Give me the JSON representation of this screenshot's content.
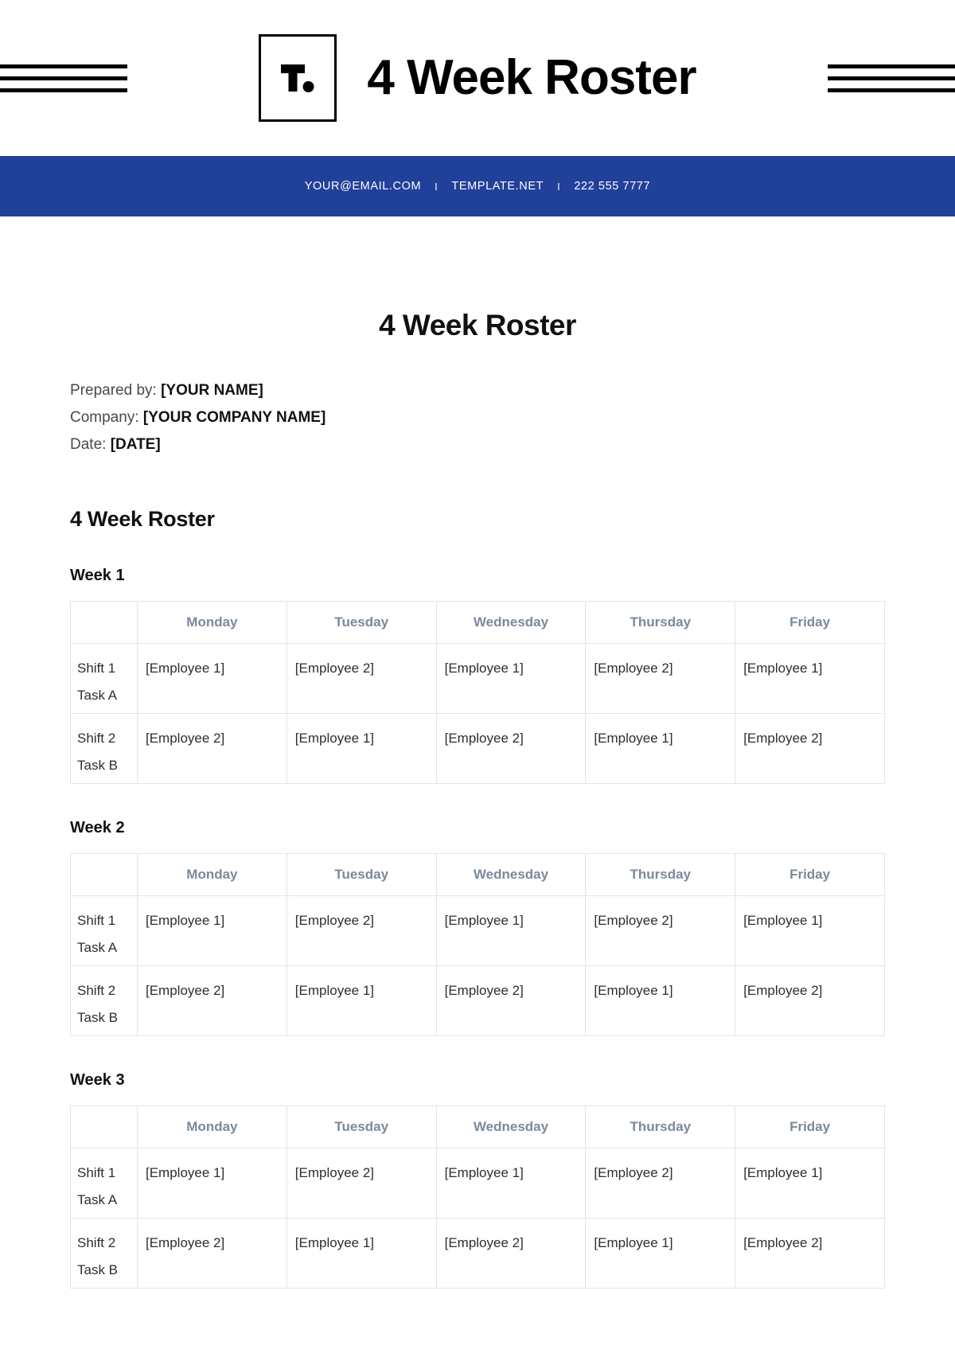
{
  "masthead": {
    "logo_letter": "T.",
    "title": "4 Week Roster",
    "decor_icon_left": "three-lines-icon",
    "decor_icon_right": "three-lines-icon"
  },
  "contact_bar": {
    "background_color": "#21409A",
    "email": "YOUR@EMAIL.COM",
    "separator": "I",
    "website": "TEMPLATE.NET",
    "phone": "222 555 7777"
  },
  "document": {
    "title": "4 Week Roster",
    "meta": [
      {
        "label": "Prepared by:",
        "value": "[YOUR NAME]"
      },
      {
        "label": "Company:",
        "value": "[YOUR COMPANY NAME]"
      },
      {
        "label": "Date:",
        "value": "[DATE]"
      }
    ],
    "section_heading": "4 Week Roster"
  },
  "table_columns": [
    "",
    "Monday",
    "Tuesday",
    "Wednesday",
    "Thursday",
    "Friday"
  ],
  "weeks": [
    {
      "heading": "Week 1",
      "rows": [
        {
          "label_line1": "Shift 1",
          "label_line2": "Task A",
          "cells": [
            "[Employee 1]",
            "[Employee 2]",
            "[Employee 1]",
            "[Employee 2]",
            "[Employee 1]"
          ]
        },
        {
          "label_line1": "Shift 2",
          "label_line2": "Task B",
          "cells": [
            "[Employee 2]",
            "[Employee 1]",
            "[Employee 2]",
            "[Employee 1]",
            "[Employee 2]"
          ]
        }
      ]
    },
    {
      "heading": "Week 2",
      "rows": [
        {
          "label_line1": "Shift 1",
          "label_line2": "Task A",
          "cells": [
            "[Employee 1]",
            "[Employee 2]",
            "[Employee 1]",
            "[Employee 2]",
            "[Employee 1]"
          ]
        },
        {
          "label_line1": "Shift 2",
          "label_line2": "Task B",
          "cells": [
            "[Employee 2]",
            "[Employee 1]",
            "[Employee 2]",
            "[Employee 1]",
            "[Employee 2]"
          ]
        }
      ]
    },
    {
      "heading": "Week 3",
      "rows": [
        {
          "label_line1": "Shift 1",
          "label_line2": "Task A",
          "cells": [
            "[Employee 1]",
            "[Employee 2]",
            "[Employee 1]",
            "[Employee 2]",
            "[Employee 1]"
          ]
        },
        {
          "label_line1": "Shift 2",
          "label_line2": "Task B",
          "cells": [
            "[Employee 2]",
            "[Employee 1]",
            "[Employee 2]",
            "[Employee 1]",
            "[Employee 2]"
          ]
        }
      ]
    }
  ]
}
